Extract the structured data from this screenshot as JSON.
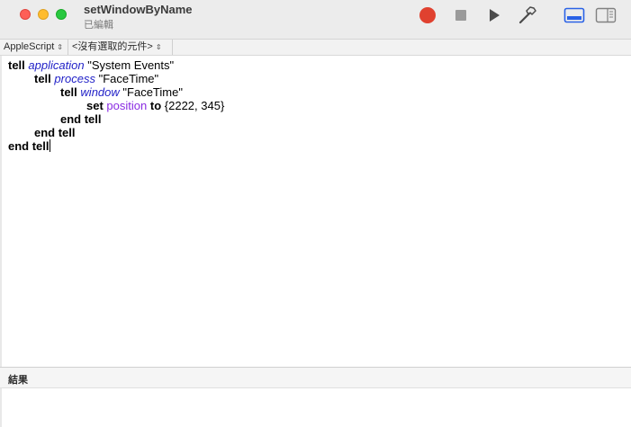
{
  "window": {
    "title": "setWindowByName",
    "subtitle": "已編輯"
  },
  "toolbar": {
    "record_icon": "record-icon",
    "stop_icon": "stop-icon",
    "run_icon": "play-icon",
    "compile_icon": "hammer-icon",
    "record_color": "#e0412f"
  },
  "navbar": {
    "language": "AppleScript",
    "element": "<沒有選取的元件>"
  },
  "code": {
    "l1": {
      "kw": "tell",
      "cls": "application",
      "str": "\"System Events\""
    },
    "l2": {
      "kw": "tell",
      "cls": "process",
      "str": "\"FaceTime\""
    },
    "l3": {
      "kw": "tell",
      "cls": "window",
      "str": "\"FaceTime\""
    },
    "l4": {
      "kw": "set",
      "prop": "position",
      "kw2": "to",
      "val": "{2222, 345}"
    },
    "l5": {
      "kw": "end tell"
    },
    "l6": {
      "kw": "end tell"
    },
    "l7": {
      "kw": "end tell"
    }
  },
  "result": {
    "label": "結果"
  }
}
